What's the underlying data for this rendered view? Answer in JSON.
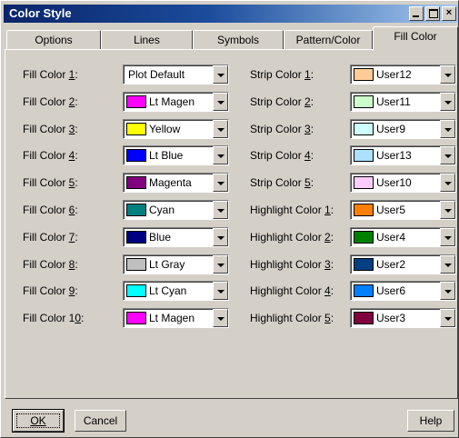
{
  "window": {
    "title": "Color Style"
  },
  "tabs": [
    {
      "label": "Options"
    },
    {
      "label": "Lines"
    },
    {
      "label": "Symbols"
    },
    {
      "label": "Pattern/Color"
    },
    {
      "label": "Fill Color"
    }
  ],
  "fill_colors": [
    {
      "label_pre": "Fill Color ",
      "label_key": "1",
      "label_post": ":",
      "value": "Plot Default",
      "swatch": null
    },
    {
      "label_pre": "Fill Color ",
      "label_key": "2",
      "label_post": ":",
      "value": "Lt Magen",
      "swatch": "#ff00ff"
    },
    {
      "label_pre": "Fill Color ",
      "label_key": "3",
      "label_post": ":",
      "value": "Yellow",
      "swatch": "#ffff00"
    },
    {
      "label_pre": "Fill Color ",
      "label_key": "4",
      "label_post": ":",
      "value": "Lt Blue",
      "swatch": "#0000ff"
    },
    {
      "label_pre": "Fill Color ",
      "label_key": "5",
      "label_post": ":",
      "value": "Magenta",
      "swatch": "#800080"
    },
    {
      "label_pre": "Fill Color ",
      "label_key": "6",
      "label_post": ":",
      "value": "Cyan",
      "swatch": "#008080"
    },
    {
      "label_pre": "Fill Color ",
      "label_key": "7",
      "label_post": ":",
      "value": "Blue",
      "swatch": "#000080"
    },
    {
      "label_pre": "Fill Color ",
      "label_key": "8",
      "label_post": ":",
      "value": "Lt Gray",
      "swatch": "#c0c0c0"
    },
    {
      "label_pre": "Fill Color ",
      "label_key": "9",
      "label_post": ":",
      "value": "Lt Cyan",
      "swatch": "#00ffff"
    },
    {
      "label_pre": "Fill Color 1",
      "label_key": "0",
      "label_post": ":",
      "value": "Lt Magen",
      "swatch": "#ff00ff"
    }
  ],
  "right_colors": [
    {
      "label_pre": "Strip Color ",
      "label_key": "1",
      "label_post": ":",
      "value": "User12",
      "swatch": "#ffcc99"
    },
    {
      "label_pre": "Strip Color ",
      "label_key": "2",
      "label_post": ":",
      "value": "User11",
      "swatch": "#ccffcc"
    },
    {
      "label_pre": "Strip Color ",
      "label_key": "3",
      "label_post": ":",
      "value": "User9",
      "swatch": "#ccffff"
    },
    {
      "label_pre": "Strip Color ",
      "label_key": "4",
      "label_post": ":",
      "value": "User13",
      "swatch": "#aee0ff"
    },
    {
      "label_pre": "Strip Color ",
      "label_key": "5",
      "label_post": ":",
      "value": "User10",
      "swatch": "#ffccff"
    },
    {
      "label_pre": "Highlight Color ",
      "label_key": "1",
      "label_post": ":",
      "value": "User5",
      "swatch": "#ff8000"
    },
    {
      "label_pre": "Highlight Color ",
      "label_key": "2",
      "label_post": ":",
      "value": "User4",
      "swatch": "#008000"
    },
    {
      "label_pre": "Highlight Color ",
      "label_key": "3",
      "label_post": ":",
      "value": "User2",
      "swatch": "#004080"
    },
    {
      "label_pre": "Highlight Color ",
      "label_key": "4",
      "label_post": ":",
      "value": "User6",
      "swatch": "#0080ff"
    },
    {
      "label_pre": "Highlight Color ",
      "label_key": "5",
      "label_post": ":",
      "value": "User3",
      "swatch": "#800040"
    }
  ],
  "buttons": {
    "ok": "OK",
    "cancel": "Cancel",
    "help": "Help"
  }
}
